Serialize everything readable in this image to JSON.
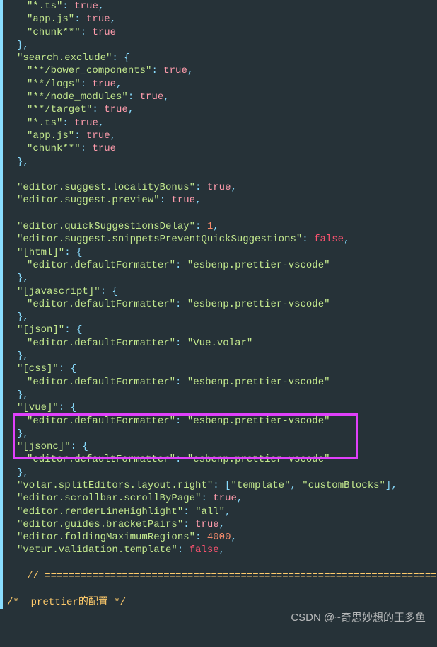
{
  "code": {
    "files_exclude": {
      "ts": "\"*.ts\": true,",
      "appjs": "\"app.js\": true,",
      "chunk": "\"chunk**\": true"
    },
    "search_exclude_key": "\"search.exclude\": {",
    "search_exclude": {
      "bower": "\"**/bower_components\": true,",
      "logs": "\"**/logs\": true,",
      "node": "\"**/node_modules\": true,",
      "target": "\"**/target\": true,",
      "ts": "\"*.ts\": true,",
      "appjs": "\"app.js\": true,",
      "chunk": "\"chunk**\": true"
    },
    "close": "},",
    "editor_locality": "\"editor.suggest.localityBonus\": true,",
    "editor_preview": "\"editor.suggest.preview\": true,",
    "quick_delay": "\"editor.quickSuggestionsDelay\": 1,",
    "snippets_prevent": "\"editor.suggest.snippetsPreventQuickSuggestions\": false,",
    "html_key": "\"[html]\": {",
    "default_formatter_key": "\"editor.defaultFormatter\":",
    "prettier_val": "\"esbenp.prettier-vscode\"",
    "volar_val": "\"Vue.volar\"",
    "js_key": "\"[javascript]\": {",
    "json_key": "\"[json]\": {",
    "css_key": "\"[css]\": {",
    "vue_key": "\"[vue]\": {",
    "jsonc_key": "\"[jsonc]\": {",
    "volar_split": "\"volar.splitEditors.layout.right\": [\"template\", \"customBlocks\"],",
    "scroll_page": "\"editor.scrollbar.scrollByPage\": true,",
    "render_line": "\"editor.renderLineHighlight\": \"all\",",
    "guides_bracket": "\"editor.guides.bracketPairs\": true,",
    "folding_max": "\"editor.foldingMaximumRegions\": 4000,",
    "vetur_validation": "\"vetur.validation.template\": false,",
    "divider": "// =====================================================================",
    "prettier_comment": "/*  prettier的配置 */"
  },
  "watermark": "CSDN @~奇思妙想的王多鱼"
}
